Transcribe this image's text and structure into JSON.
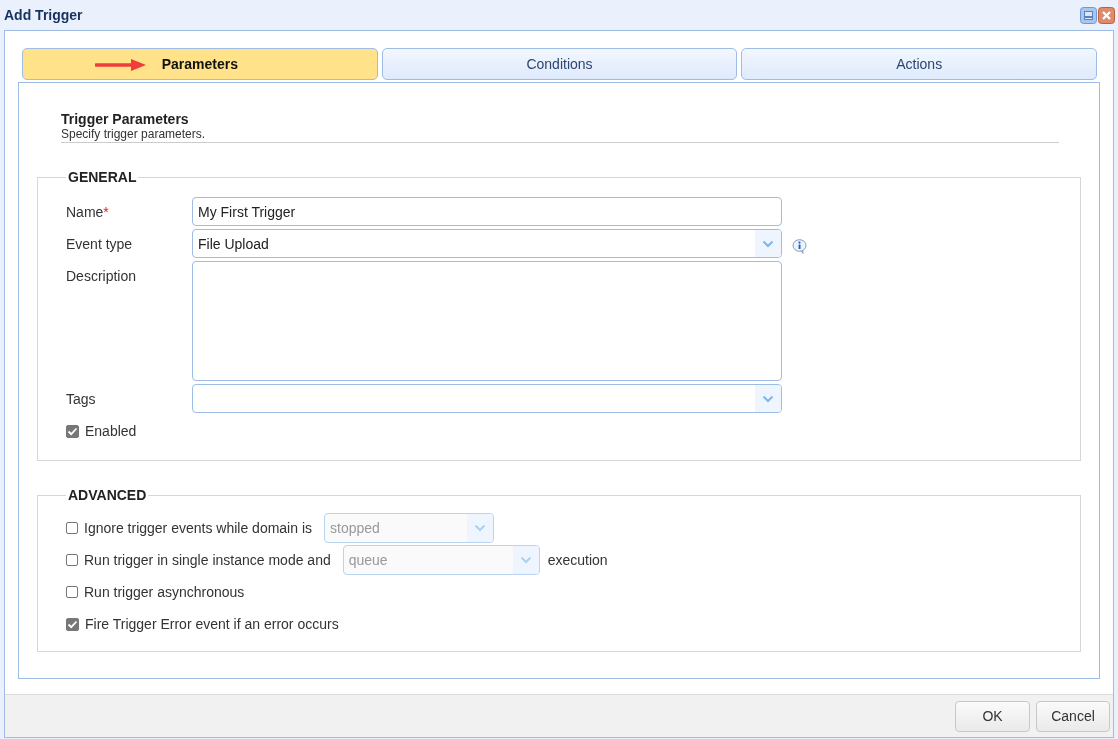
{
  "window": {
    "title": "Add Trigger"
  },
  "tabs": [
    {
      "label": "Parameters",
      "selected": true,
      "arrow": true
    },
    {
      "label": "Conditions",
      "selected": false
    },
    {
      "label": "Actions",
      "selected": false
    }
  ],
  "heading": {
    "title": "Trigger Parameters",
    "subtitle": "Specify trigger parameters."
  },
  "general": {
    "legend": "GENERAL",
    "fields": [
      {
        "kind": "text",
        "label": "Name",
        "required_mark": "*",
        "value": "My First Trigger"
      },
      {
        "kind": "select",
        "label": "Event type",
        "value": "File Upload",
        "info": true
      },
      {
        "kind": "textarea",
        "label": "Description"
      },
      {
        "kind": "select",
        "label": "Tags"
      }
    ],
    "enabled": {
      "label": "Enabled",
      "checked": true
    }
  },
  "advanced": {
    "legend": "ADVANCED",
    "options": [
      {
        "label": "Ignore trigger events while domain is",
        "checked": false,
        "select": {
          "value": "stopped",
          "disabled": true
        }
      },
      {
        "label": "Run trigger in single instance mode and",
        "checked": false,
        "select": {
          "value": "queue",
          "disabled": true
        },
        "suffix": "execution"
      },
      {
        "label": "Run trigger asynchronous",
        "checked": false
      },
      {
        "label": "Fire Trigger Error event if an error occurs",
        "checked": true
      }
    ]
  },
  "buttons": [
    "OK",
    "Cancel"
  ]
}
